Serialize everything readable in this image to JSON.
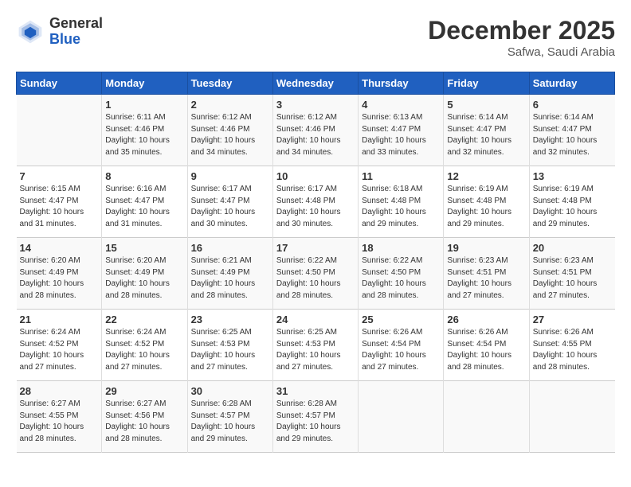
{
  "logo": {
    "general": "General",
    "blue": "Blue"
  },
  "title": "December 2025",
  "subtitle": "Safwa, Saudi Arabia",
  "days_header": [
    "Sunday",
    "Monday",
    "Tuesday",
    "Wednesday",
    "Thursday",
    "Friday",
    "Saturday"
  ],
  "weeks": [
    [
      {
        "num": "",
        "info": ""
      },
      {
        "num": "1",
        "info": "Sunrise: 6:11 AM\nSunset: 4:46 PM\nDaylight: 10 hours\nand 35 minutes."
      },
      {
        "num": "2",
        "info": "Sunrise: 6:12 AM\nSunset: 4:46 PM\nDaylight: 10 hours\nand 34 minutes."
      },
      {
        "num": "3",
        "info": "Sunrise: 6:12 AM\nSunset: 4:46 PM\nDaylight: 10 hours\nand 34 minutes."
      },
      {
        "num": "4",
        "info": "Sunrise: 6:13 AM\nSunset: 4:47 PM\nDaylight: 10 hours\nand 33 minutes."
      },
      {
        "num": "5",
        "info": "Sunrise: 6:14 AM\nSunset: 4:47 PM\nDaylight: 10 hours\nand 32 minutes."
      },
      {
        "num": "6",
        "info": "Sunrise: 6:14 AM\nSunset: 4:47 PM\nDaylight: 10 hours\nand 32 minutes."
      }
    ],
    [
      {
        "num": "7",
        "info": "Sunrise: 6:15 AM\nSunset: 4:47 PM\nDaylight: 10 hours\nand 31 minutes."
      },
      {
        "num": "8",
        "info": "Sunrise: 6:16 AM\nSunset: 4:47 PM\nDaylight: 10 hours\nand 31 minutes."
      },
      {
        "num": "9",
        "info": "Sunrise: 6:17 AM\nSunset: 4:47 PM\nDaylight: 10 hours\nand 30 minutes."
      },
      {
        "num": "10",
        "info": "Sunrise: 6:17 AM\nSunset: 4:48 PM\nDaylight: 10 hours\nand 30 minutes."
      },
      {
        "num": "11",
        "info": "Sunrise: 6:18 AM\nSunset: 4:48 PM\nDaylight: 10 hours\nand 29 minutes."
      },
      {
        "num": "12",
        "info": "Sunrise: 6:19 AM\nSunset: 4:48 PM\nDaylight: 10 hours\nand 29 minutes."
      },
      {
        "num": "13",
        "info": "Sunrise: 6:19 AM\nSunset: 4:48 PM\nDaylight: 10 hours\nand 29 minutes."
      }
    ],
    [
      {
        "num": "14",
        "info": "Sunrise: 6:20 AM\nSunset: 4:49 PM\nDaylight: 10 hours\nand 28 minutes."
      },
      {
        "num": "15",
        "info": "Sunrise: 6:20 AM\nSunset: 4:49 PM\nDaylight: 10 hours\nand 28 minutes."
      },
      {
        "num": "16",
        "info": "Sunrise: 6:21 AM\nSunset: 4:49 PM\nDaylight: 10 hours\nand 28 minutes."
      },
      {
        "num": "17",
        "info": "Sunrise: 6:22 AM\nSunset: 4:50 PM\nDaylight: 10 hours\nand 28 minutes."
      },
      {
        "num": "18",
        "info": "Sunrise: 6:22 AM\nSunset: 4:50 PM\nDaylight: 10 hours\nand 28 minutes."
      },
      {
        "num": "19",
        "info": "Sunrise: 6:23 AM\nSunset: 4:51 PM\nDaylight: 10 hours\nand 27 minutes."
      },
      {
        "num": "20",
        "info": "Sunrise: 6:23 AM\nSunset: 4:51 PM\nDaylight: 10 hours\nand 27 minutes."
      }
    ],
    [
      {
        "num": "21",
        "info": "Sunrise: 6:24 AM\nSunset: 4:52 PM\nDaylight: 10 hours\nand 27 minutes."
      },
      {
        "num": "22",
        "info": "Sunrise: 6:24 AM\nSunset: 4:52 PM\nDaylight: 10 hours\nand 27 minutes."
      },
      {
        "num": "23",
        "info": "Sunrise: 6:25 AM\nSunset: 4:53 PM\nDaylight: 10 hours\nand 27 minutes."
      },
      {
        "num": "24",
        "info": "Sunrise: 6:25 AM\nSunset: 4:53 PM\nDaylight: 10 hours\nand 27 minutes."
      },
      {
        "num": "25",
        "info": "Sunrise: 6:26 AM\nSunset: 4:54 PM\nDaylight: 10 hours\nand 27 minutes."
      },
      {
        "num": "26",
        "info": "Sunrise: 6:26 AM\nSunset: 4:54 PM\nDaylight: 10 hours\nand 28 minutes."
      },
      {
        "num": "27",
        "info": "Sunrise: 6:26 AM\nSunset: 4:55 PM\nDaylight: 10 hours\nand 28 minutes."
      }
    ],
    [
      {
        "num": "28",
        "info": "Sunrise: 6:27 AM\nSunset: 4:55 PM\nDaylight: 10 hours\nand 28 minutes."
      },
      {
        "num": "29",
        "info": "Sunrise: 6:27 AM\nSunset: 4:56 PM\nDaylight: 10 hours\nand 28 minutes."
      },
      {
        "num": "30",
        "info": "Sunrise: 6:28 AM\nSunset: 4:57 PM\nDaylight: 10 hours\nand 29 minutes."
      },
      {
        "num": "31",
        "info": "Sunrise: 6:28 AM\nSunset: 4:57 PM\nDaylight: 10 hours\nand 29 minutes."
      },
      {
        "num": "",
        "info": ""
      },
      {
        "num": "",
        "info": ""
      },
      {
        "num": "",
        "info": ""
      }
    ]
  ]
}
